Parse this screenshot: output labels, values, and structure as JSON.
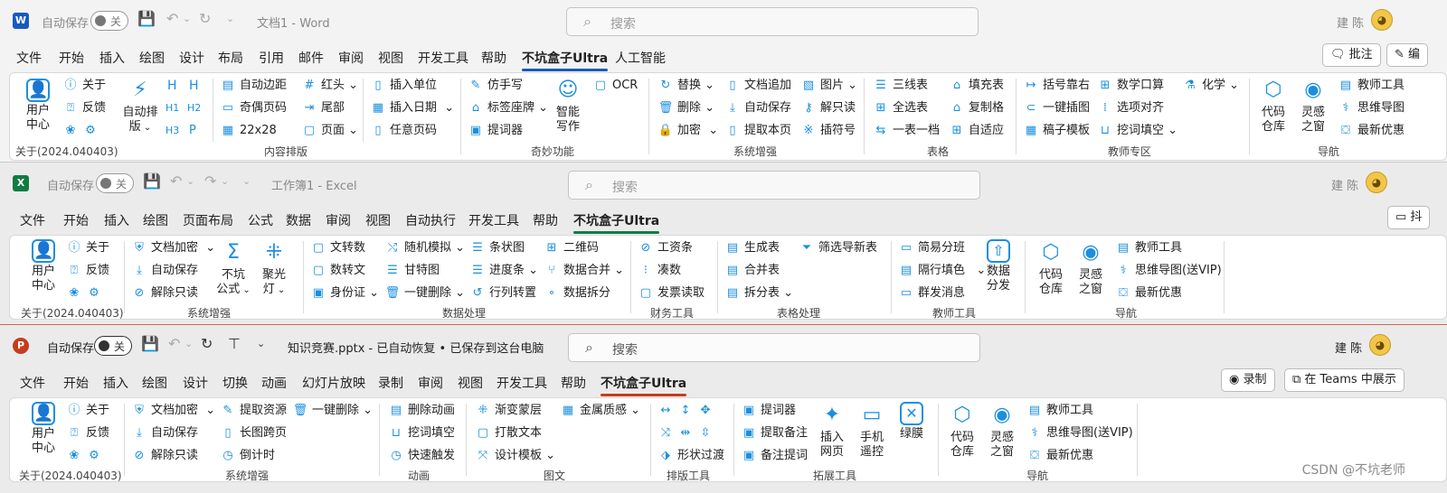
{
  "word": {
    "app_icon": "W",
    "autosave": "自动保存",
    "toggle": "关",
    "title": "文档1  -  Word",
    "search": "搜索",
    "user": "建 陈",
    "tabs": [
      "文件",
      "开始",
      "插入",
      "绘图",
      "设计",
      "布局",
      "引用",
      "邮件",
      "审阅",
      "视图",
      "开发工具",
      "帮助",
      "不坑盒子Ultra",
      "人工智能"
    ],
    "btn_comment": "批注",
    "btn_edit": "编",
    "ribbon": {
      "user_center": "用户中心",
      "about": "关于",
      "feedback": "反馈",
      "about_version": "关于(2024.040403)",
      "auto_layout": "自动排版",
      "h1": "H",
      "h2": "H",
      "h1b": "H1",
      "h2b": "H2",
      "h3": "H3",
      "para": "P",
      "auto_margin": "自动边距",
      "odd_even_page": "奇偶页码",
      "grid": "22x28",
      "red_head": "红头",
      "tail": "尾部",
      "page": "页面",
      "insert_unit": "插入单位",
      "insert_date": "插入日期",
      "any_page": "任意页码",
      "group_content": "内容排版",
      "imitate": "仿手写",
      "label_seat": "标签座牌",
      "prompter": "提词器",
      "ai_write": "智能写作",
      "ocr": "OCR",
      "group_magic": "奇妙功能",
      "replace": "替换",
      "delete": "删除",
      "encrypt": "加密",
      "doc_append": "文档追加",
      "auto_save": "自动保存",
      "extract_page": "提取本页",
      "image": "图片",
      "unlock_readonly": "解只读",
      "insert_symbol": "插符号",
      "group_enhance": "系统增强",
      "three_line": "三线表",
      "select_table": "全选表",
      "one_table_one": "一表一档",
      "fill_table": "填充表",
      "copy_format": "复制格",
      "auto_fit": "自适应",
      "group_table": "表格",
      "bracket_right": "括号靠右",
      "one_key_image": "一键插图",
      "draft_template": "稿子模板",
      "math_calc": "数学口算",
      "option_align": "选项对齐",
      "cloze": "挖词填空",
      "chemistry": "化学",
      "group_teacher": "教师专区",
      "code_repo": "代码仓库",
      "inspiration": "灵感之窗",
      "teacher_tools": "教师工具",
      "mind_map": "思维导图",
      "latest_offer": "最新优惠",
      "group_nav": "导航"
    }
  },
  "excel": {
    "app_icon": "X",
    "autosave": "自动保存",
    "toggle": "关",
    "title": "工作簿1  -  Excel",
    "search": "搜索",
    "user": "建 陈",
    "tabs": [
      "文件",
      "开始",
      "插入",
      "绘图",
      "页面布局",
      "公式",
      "数据",
      "审阅",
      "视图",
      "自动执行",
      "开发工具",
      "帮助",
      "不坑盒子Ultra"
    ],
    "btn_side": "抖",
    "ribbon": {
      "user_center": "用户中心",
      "about": "关于",
      "feedback": "反馈",
      "about_version": "关于(2024.040403)",
      "doc_encrypt": "文档加密",
      "auto_save": "自动保存",
      "unlock_readonly": "解除只读",
      "formula": "不坑公式",
      "spotlight": "聚光灯",
      "group_enhance": "系统增强",
      "text_to_num": "文转数",
      "num_to_text": "数转文",
      "id_card": "身份证",
      "random_sim": "随机模拟",
      "gantt": "甘特图",
      "one_key_delete": "一键删除",
      "bar_chart": "条状图",
      "progress_bar": "进度条",
      "row_col": "行列转置",
      "qrcode": "二维码",
      "data_merge": "数据合并",
      "data_split": "数据拆分",
      "group_data": "数据处理",
      "payslip": "工资条",
      "make_up": "凑数",
      "invoice_read": "发票读取",
      "group_finance": "财务工具",
      "gen_table": "生成表",
      "merge_table": "合并表",
      "split_table": "拆分表",
      "filter_new": "筛选导新表",
      "group_table": "表格处理",
      "simple_group": "简易分班",
      "alt_fill": "隔行填色",
      "group_msg": "群发消息",
      "data_dist": "数据分发",
      "group_teacher": "教师工具",
      "code_repo": "代码仓库",
      "inspiration": "灵感之窗",
      "teacher_tools": "教师工具",
      "mind_map_vip": "思维导图(送VIP)",
      "latest_offer": "最新优惠",
      "group_nav": "导航"
    }
  },
  "ppt": {
    "app_icon": "P",
    "autosave": "自动保存",
    "toggle": "关",
    "title": "知识竞赛.pptx  -  已自动恢复 • 已保存到这台电脑",
    "search": "搜索",
    "user": "建 陈",
    "tabs": [
      "文件",
      "开始",
      "插入",
      "绘图",
      "设计",
      "切换",
      "动画",
      "幻灯片放映",
      "录制",
      "审阅",
      "视图",
      "开发工具",
      "帮助",
      "不坑盒子Ultra"
    ],
    "btn_record": "录制",
    "btn_teams": "在 Teams 中展示",
    "ribbon": {
      "user_center": "用户中心",
      "about": "关于",
      "feedback": "反馈",
      "about_version": "关于(2024.040403)",
      "doc_encrypt": "文档加密",
      "auto_save": "自动保存",
      "unlock_readonly": "解除只读",
      "extract_res": "提取资源",
      "long_image": "长图跨页",
      "countdown": "倒计时",
      "one_key_delete": "一键删除",
      "group_enhance": "系统增强",
      "del_anim": "删除动画",
      "cloze": "挖词填空",
      "quick_trigger": "快速触发",
      "group_anim": "动画",
      "gradient_mask": "渐变蒙层",
      "scatter_text": "打散文本",
      "design_template": "设计模板",
      "metal": "金属质感",
      "group_imgtext": "图文",
      "shape_transition": "形状过渡",
      "group_layout": "排版工具",
      "prompter": "提词器",
      "extract_notes": "提取备注",
      "notes_prompt": "备注提词",
      "insert_web": "插入网页",
      "phone_remote": "手机遥控",
      "green_screen": "绿膜",
      "group_ext": "拓展工具",
      "code_repo": "代码仓库",
      "inspiration": "灵感之窗",
      "teacher_tools": "教师工具",
      "mind_map_vip": "思维导图(送VIP)",
      "latest_offer": "最新优惠",
      "group_nav": "导航"
    }
  },
  "watermark": "CSDN @不坑老师",
  "colors": {
    "word": "#185abd",
    "excel": "#107c41",
    "ppt": "#c43e1c",
    "icon": "#1a8fe0"
  }
}
